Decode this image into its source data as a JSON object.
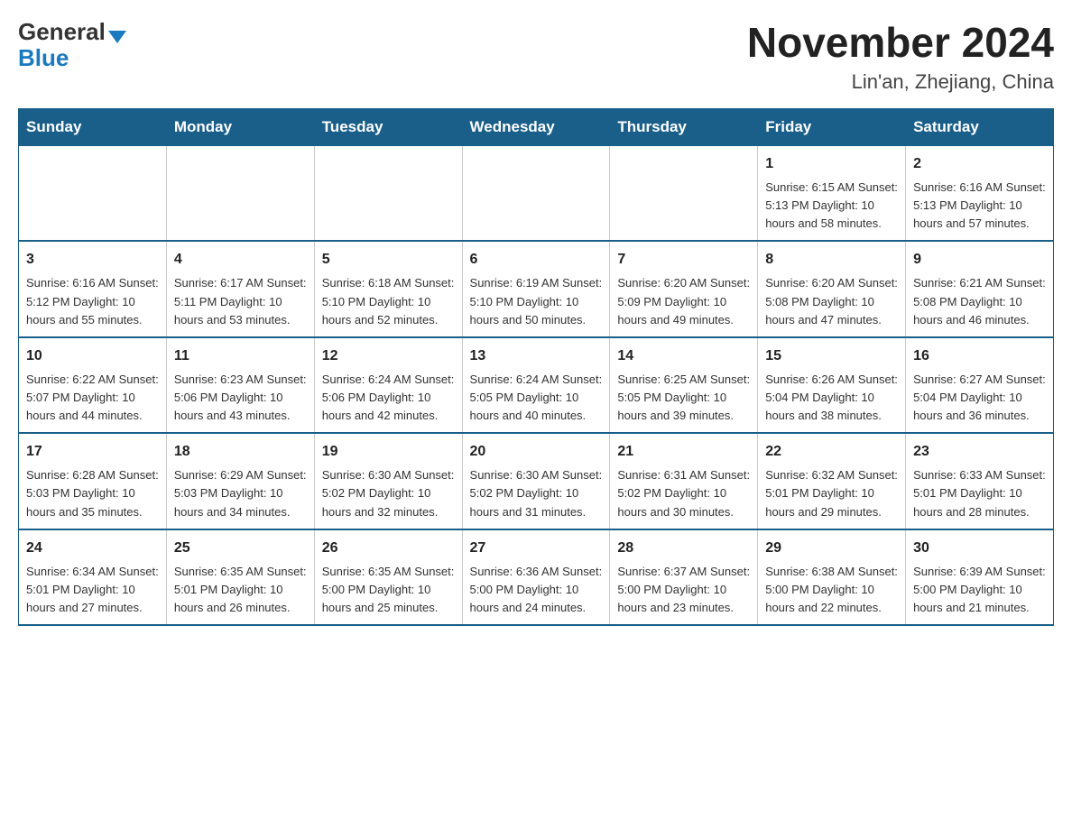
{
  "logo": {
    "general": "General",
    "blue": "Blue"
  },
  "title": "November 2024",
  "location": "Lin'an, Zhejiang, China",
  "weekdays": [
    "Sunday",
    "Monday",
    "Tuesday",
    "Wednesday",
    "Thursday",
    "Friday",
    "Saturday"
  ],
  "weeks": [
    [
      {
        "day": "",
        "info": ""
      },
      {
        "day": "",
        "info": ""
      },
      {
        "day": "",
        "info": ""
      },
      {
        "day": "",
        "info": ""
      },
      {
        "day": "",
        "info": ""
      },
      {
        "day": "1",
        "info": "Sunrise: 6:15 AM\nSunset: 5:13 PM\nDaylight: 10 hours and 58 minutes."
      },
      {
        "day": "2",
        "info": "Sunrise: 6:16 AM\nSunset: 5:13 PM\nDaylight: 10 hours and 57 minutes."
      }
    ],
    [
      {
        "day": "3",
        "info": "Sunrise: 6:16 AM\nSunset: 5:12 PM\nDaylight: 10 hours and 55 minutes."
      },
      {
        "day": "4",
        "info": "Sunrise: 6:17 AM\nSunset: 5:11 PM\nDaylight: 10 hours and 53 minutes."
      },
      {
        "day": "5",
        "info": "Sunrise: 6:18 AM\nSunset: 5:10 PM\nDaylight: 10 hours and 52 minutes."
      },
      {
        "day": "6",
        "info": "Sunrise: 6:19 AM\nSunset: 5:10 PM\nDaylight: 10 hours and 50 minutes."
      },
      {
        "day": "7",
        "info": "Sunrise: 6:20 AM\nSunset: 5:09 PM\nDaylight: 10 hours and 49 minutes."
      },
      {
        "day": "8",
        "info": "Sunrise: 6:20 AM\nSunset: 5:08 PM\nDaylight: 10 hours and 47 minutes."
      },
      {
        "day": "9",
        "info": "Sunrise: 6:21 AM\nSunset: 5:08 PM\nDaylight: 10 hours and 46 minutes."
      }
    ],
    [
      {
        "day": "10",
        "info": "Sunrise: 6:22 AM\nSunset: 5:07 PM\nDaylight: 10 hours and 44 minutes."
      },
      {
        "day": "11",
        "info": "Sunrise: 6:23 AM\nSunset: 5:06 PM\nDaylight: 10 hours and 43 minutes."
      },
      {
        "day": "12",
        "info": "Sunrise: 6:24 AM\nSunset: 5:06 PM\nDaylight: 10 hours and 42 minutes."
      },
      {
        "day": "13",
        "info": "Sunrise: 6:24 AM\nSunset: 5:05 PM\nDaylight: 10 hours and 40 minutes."
      },
      {
        "day": "14",
        "info": "Sunrise: 6:25 AM\nSunset: 5:05 PM\nDaylight: 10 hours and 39 minutes."
      },
      {
        "day": "15",
        "info": "Sunrise: 6:26 AM\nSunset: 5:04 PM\nDaylight: 10 hours and 38 minutes."
      },
      {
        "day": "16",
        "info": "Sunrise: 6:27 AM\nSunset: 5:04 PM\nDaylight: 10 hours and 36 minutes."
      }
    ],
    [
      {
        "day": "17",
        "info": "Sunrise: 6:28 AM\nSunset: 5:03 PM\nDaylight: 10 hours and 35 minutes."
      },
      {
        "day": "18",
        "info": "Sunrise: 6:29 AM\nSunset: 5:03 PM\nDaylight: 10 hours and 34 minutes."
      },
      {
        "day": "19",
        "info": "Sunrise: 6:30 AM\nSunset: 5:02 PM\nDaylight: 10 hours and 32 minutes."
      },
      {
        "day": "20",
        "info": "Sunrise: 6:30 AM\nSunset: 5:02 PM\nDaylight: 10 hours and 31 minutes."
      },
      {
        "day": "21",
        "info": "Sunrise: 6:31 AM\nSunset: 5:02 PM\nDaylight: 10 hours and 30 minutes."
      },
      {
        "day": "22",
        "info": "Sunrise: 6:32 AM\nSunset: 5:01 PM\nDaylight: 10 hours and 29 minutes."
      },
      {
        "day": "23",
        "info": "Sunrise: 6:33 AM\nSunset: 5:01 PM\nDaylight: 10 hours and 28 minutes."
      }
    ],
    [
      {
        "day": "24",
        "info": "Sunrise: 6:34 AM\nSunset: 5:01 PM\nDaylight: 10 hours and 27 minutes."
      },
      {
        "day": "25",
        "info": "Sunrise: 6:35 AM\nSunset: 5:01 PM\nDaylight: 10 hours and 26 minutes."
      },
      {
        "day": "26",
        "info": "Sunrise: 6:35 AM\nSunset: 5:00 PM\nDaylight: 10 hours and 25 minutes."
      },
      {
        "day": "27",
        "info": "Sunrise: 6:36 AM\nSunset: 5:00 PM\nDaylight: 10 hours and 24 minutes."
      },
      {
        "day": "28",
        "info": "Sunrise: 6:37 AM\nSunset: 5:00 PM\nDaylight: 10 hours and 23 minutes."
      },
      {
        "day": "29",
        "info": "Sunrise: 6:38 AM\nSunset: 5:00 PM\nDaylight: 10 hours and 22 minutes."
      },
      {
        "day": "30",
        "info": "Sunrise: 6:39 AM\nSunset: 5:00 PM\nDaylight: 10 hours and 21 minutes."
      }
    ]
  ]
}
